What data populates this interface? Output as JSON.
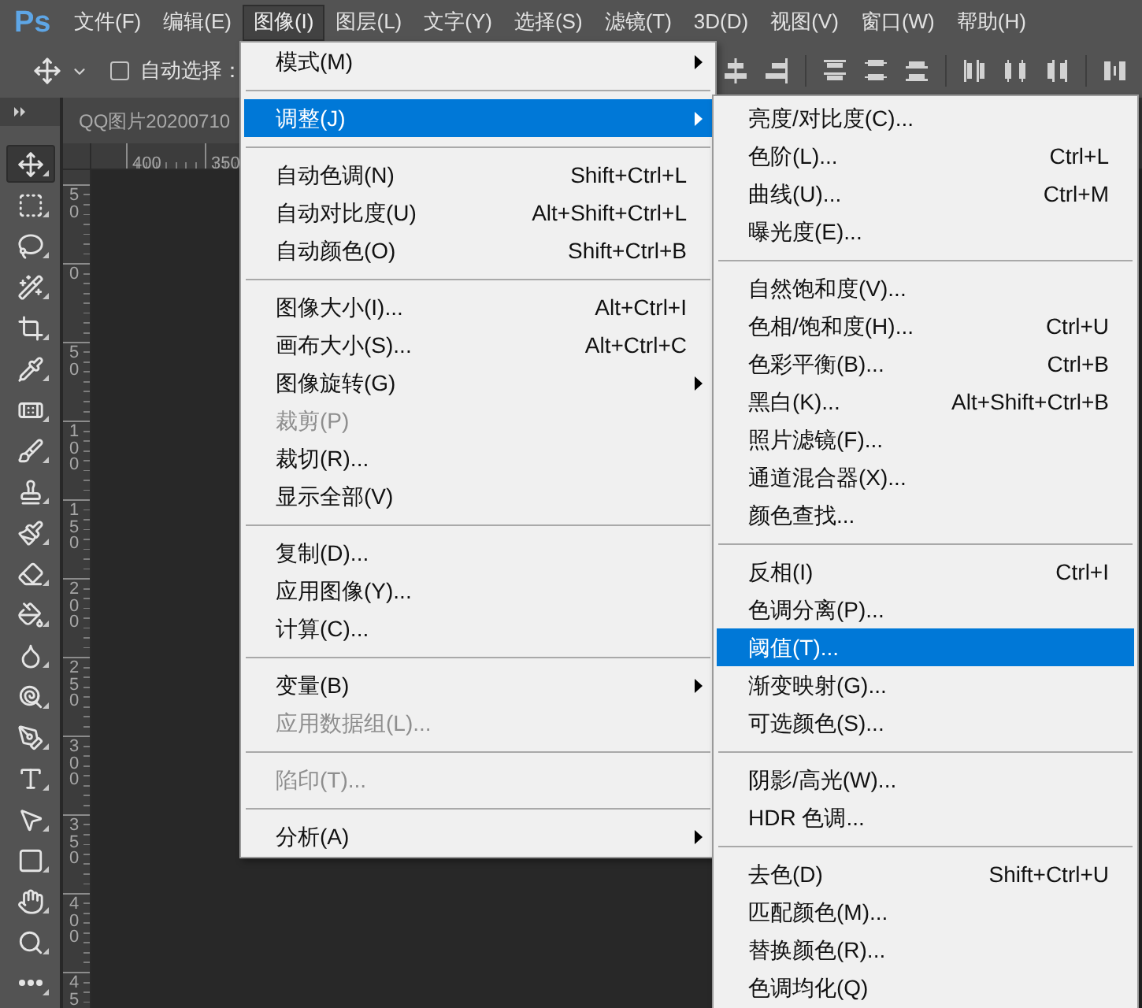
{
  "app": {
    "logo": "Ps"
  },
  "menu_bar": [
    {
      "label": "文件(F)",
      "selected": false
    },
    {
      "label": "编辑(E)",
      "selected": false
    },
    {
      "label": "图像(I)",
      "selected": true
    },
    {
      "label": "图层(L)",
      "selected": false
    },
    {
      "label": "文字(Y)",
      "selected": false
    },
    {
      "label": "选择(S)",
      "selected": false
    },
    {
      "label": "滤镜(T)",
      "selected": false
    },
    {
      "label": "3D(D)",
      "selected": false
    },
    {
      "label": "视图(V)",
      "selected": false
    },
    {
      "label": "窗口(W)",
      "selected": false
    },
    {
      "label": "帮助(H)",
      "selected": false
    }
  ],
  "options_bar": {
    "auto_select": {
      "label": "自动选择：",
      "checked": false
    }
  },
  "tools": [
    {
      "kind": "move",
      "selected": true
    },
    {
      "kind": "marquee",
      "selected": false
    },
    {
      "kind": "lasso",
      "selected": false
    },
    {
      "kind": "wand",
      "selected": false
    },
    {
      "kind": "crop",
      "selected": false
    },
    {
      "kind": "eyedropper",
      "selected": false
    },
    {
      "kind": "healing",
      "selected": false
    },
    {
      "kind": "brush",
      "selected": false
    },
    {
      "kind": "stamp",
      "selected": false
    },
    {
      "kind": "history",
      "selected": false
    },
    {
      "kind": "eraser",
      "selected": false
    },
    {
      "kind": "bucket",
      "selected": false
    },
    {
      "kind": "blur",
      "selected": false
    },
    {
      "kind": "dodge",
      "selected": false
    },
    {
      "kind": "pen",
      "selected": false
    },
    {
      "kind": "type",
      "selected": false
    },
    {
      "kind": "selection",
      "selected": false
    },
    {
      "kind": "rectangle",
      "selected": false
    },
    {
      "kind": "hand",
      "selected": false
    },
    {
      "kind": "zoom",
      "selected": false
    },
    {
      "kind": "more",
      "selected": false
    }
  ],
  "document_tab": {
    "title": "QQ图片20200710"
  },
  "rulers": {
    "horizontal": [
      "400",
      "350"
    ],
    "vertical": [
      "50",
      "0",
      "50",
      "100",
      "150",
      "200",
      "250",
      "300",
      "350",
      "400",
      "45"
    ]
  },
  "image_menu": {
    "items": [
      {
        "kind": "item",
        "label": "模式(M)",
        "submenu": true,
        "disabled": false,
        "selected": false
      },
      {
        "kind": "separator"
      },
      {
        "kind": "item",
        "label": "调整(J)",
        "submenu": true,
        "disabled": false,
        "selected": true
      },
      {
        "kind": "separator"
      },
      {
        "kind": "item",
        "label": "自动色调(N)",
        "shortcut": "Shift+Ctrl+L",
        "submenu": false,
        "disabled": false,
        "selected": false
      },
      {
        "kind": "item",
        "label": "自动对比度(U)",
        "shortcut": "Alt+Shift+Ctrl+L",
        "submenu": false,
        "disabled": false,
        "selected": false
      },
      {
        "kind": "item",
        "label": "自动颜色(O)",
        "shortcut": "Shift+Ctrl+B",
        "submenu": false,
        "disabled": false,
        "selected": false
      },
      {
        "kind": "separator"
      },
      {
        "kind": "item",
        "label": "图像大小(I)...",
        "shortcut": "Alt+Ctrl+I",
        "submenu": false,
        "disabled": false,
        "selected": false
      },
      {
        "kind": "item",
        "label": "画布大小(S)...",
        "shortcut": "Alt+Ctrl+C",
        "submenu": false,
        "disabled": false,
        "selected": false
      },
      {
        "kind": "item",
        "label": "图像旋转(G)",
        "submenu": true,
        "disabled": false,
        "selected": false
      },
      {
        "kind": "item",
        "label": "裁剪(P)",
        "submenu": false,
        "disabled": true,
        "selected": false
      },
      {
        "kind": "item",
        "label": "裁切(R)...",
        "submenu": false,
        "disabled": false,
        "selected": false
      },
      {
        "kind": "item",
        "label": "显示全部(V)",
        "submenu": false,
        "disabled": false,
        "selected": false
      },
      {
        "kind": "separator"
      },
      {
        "kind": "item",
        "label": "复制(D)...",
        "submenu": false,
        "disabled": false,
        "selected": false
      },
      {
        "kind": "item",
        "label": "应用图像(Y)...",
        "submenu": false,
        "disabled": false,
        "selected": false
      },
      {
        "kind": "item",
        "label": "计算(C)...",
        "submenu": false,
        "disabled": false,
        "selected": false
      },
      {
        "kind": "separator"
      },
      {
        "kind": "item",
        "label": "变量(B)",
        "submenu": true,
        "disabled": false,
        "selected": false
      },
      {
        "kind": "item",
        "label": "应用数据组(L)...",
        "submenu": false,
        "disabled": true,
        "selected": false
      },
      {
        "kind": "separator"
      },
      {
        "kind": "item",
        "label": "陷印(T)...",
        "submenu": false,
        "disabled": true,
        "selected": false
      },
      {
        "kind": "separator"
      },
      {
        "kind": "item",
        "label": "分析(A)",
        "submenu": true,
        "disabled": false,
        "selected": false
      }
    ]
  },
  "adjustments_submenu": {
    "items": [
      {
        "kind": "item",
        "label": "亮度/对比度(C)...",
        "selected": false
      },
      {
        "kind": "item",
        "label": "色阶(L)...",
        "shortcut": "Ctrl+L",
        "selected": false
      },
      {
        "kind": "item",
        "label": "曲线(U)...",
        "shortcut": "Ctrl+M",
        "selected": false
      },
      {
        "kind": "item",
        "label": "曝光度(E)...",
        "selected": false
      },
      {
        "kind": "separator"
      },
      {
        "kind": "item",
        "label": "自然饱和度(V)...",
        "selected": false
      },
      {
        "kind": "item",
        "label": "色相/饱和度(H)...",
        "shortcut": "Ctrl+U",
        "selected": false
      },
      {
        "kind": "item",
        "label": "色彩平衡(B)...",
        "shortcut": "Ctrl+B",
        "selected": false
      },
      {
        "kind": "item",
        "label": "黑白(K)...",
        "shortcut": "Alt+Shift+Ctrl+B",
        "selected": false
      },
      {
        "kind": "item",
        "label": "照片滤镜(F)...",
        "selected": false
      },
      {
        "kind": "item",
        "label": "通道混合器(X)...",
        "selected": false
      },
      {
        "kind": "item",
        "label": "颜色查找...",
        "selected": false
      },
      {
        "kind": "separator"
      },
      {
        "kind": "item",
        "label": "反相(I)",
        "shortcut": "Ctrl+I",
        "selected": false
      },
      {
        "kind": "item",
        "label": "色调分离(P)...",
        "selected": false
      },
      {
        "kind": "item",
        "label": "阈值(T)...",
        "selected": true
      },
      {
        "kind": "item",
        "label": "渐变映射(G)...",
        "selected": false
      },
      {
        "kind": "item",
        "label": "可选颜色(S)...",
        "selected": false
      },
      {
        "kind": "separator"
      },
      {
        "kind": "item",
        "label": "阴影/高光(W)...",
        "selected": false
      },
      {
        "kind": "item",
        "label": "HDR 色调...",
        "selected": false
      },
      {
        "kind": "separator"
      },
      {
        "kind": "item",
        "label": "去色(D)",
        "shortcut": "Shift+Ctrl+U",
        "selected": false
      },
      {
        "kind": "item",
        "label": "匹配颜色(M)...",
        "selected": false
      },
      {
        "kind": "item",
        "label": "替换颜色(R)...",
        "selected": false
      },
      {
        "kind": "item",
        "label": "色调均化(Q)",
        "selected": false
      }
    ]
  }
}
